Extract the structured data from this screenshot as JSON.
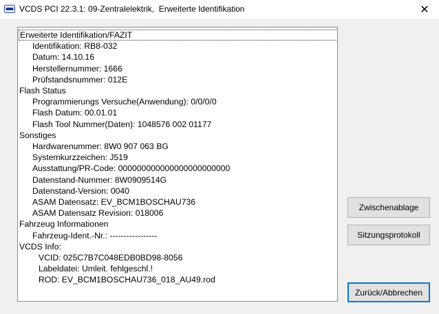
{
  "window": {
    "title": "VCDS PCI 22.3.1: 09-Zentralelektrik,  Erweiterte Identifikation",
    "close_glyph": "✕"
  },
  "list": [
    {
      "text": "Erweiterte Identifikation/FAZIT",
      "level": 0,
      "selected": true
    },
    {
      "text": "Identifikation: RB8-032",
      "level": 1
    },
    {
      "text": "Datum: 14.10.16",
      "level": 1
    },
    {
      "text": "Herstellernummer: 1666",
      "level": 1
    },
    {
      "text": "Prüfstandsnummer: 012E",
      "level": 1
    },
    {
      "text": "Flash Status",
      "level": 0
    },
    {
      "text": "Programmierungs Versuche(Anwendung): 0/0/0/0",
      "level": 1
    },
    {
      "text": "Flash Datum: 00.01.01",
      "level": 1
    },
    {
      "text": "Flash Tool Nummer(Daten): 1048576 002 01177",
      "level": 1
    },
    {
      "text": "Sonstiges",
      "level": 0
    },
    {
      "text": "Hardwarenummer: 8W0 907 063 BG",
      "level": 1
    },
    {
      "text": "Systemkurzzeichen: J519",
      "level": 1
    },
    {
      "text": "Ausstattung/PR-Code: 000000000000000000000000",
      "level": 1
    },
    {
      "text": "Datenstand-Nummer: 8W0909514G",
      "level": 1
    },
    {
      "text": "Datenstand-Version: 0040",
      "level": 1
    },
    {
      "text": "ASAM Datensatz: EV_BCM1BOSCHAU736",
      "level": 1
    },
    {
      "text": "ASAM Datensatz Revision: 018006",
      "level": 1
    },
    {
      "text": "Fahrzeug Informationen",
      "level": 0
    },
    {
      "text": "Fahrzeug-Ident.-Nr.: -----------------",
      "level": 1
    },
    {
      "text": "VCDS Info:",
      "level": 0
    },
    {
      "text": "VCID: 025C7B7C048EDB0BD98-8056",
      "level": 2
    },
    {
      "text": "Labeldatei: Umleit. fehlgeschl.!",
      "level": 2
    },
    {
      "text": "ROD: EV_BCM1BOSCHAU736_018_AU49.rod",
      "level": 2
    }
  ],
  "buttons": {
    "clipboard": "Zwischenablage",
    "session_log": "Sitzungsprotokoll",
    "back_cancel": "Zurück/Abbrechen"
  },
  "colors": {
    "accent": "#0078d7"
  }
}
